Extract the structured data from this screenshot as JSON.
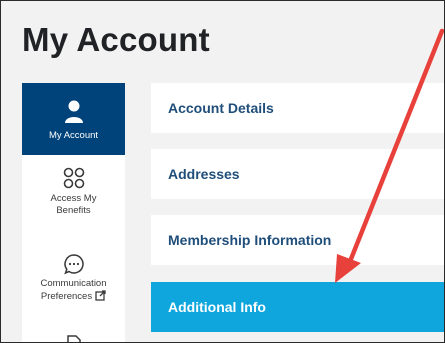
{
  "page": {
    "title": "My Account"
  },
  "sidebar": {
    "items": [
      {
        "label": "My Account",
        "icon": "user-icon"
      },
      {
        "label": "Access My Benefits",
        "icon": "grid-icon"
      },
      {
        "label": "Communication Preferences",
        "icon": "chat-bubble-icon",
        "external_icon": "external-link-icon"
      },
      {
        "label": "",
        "icon": "document-icon"
      }
    ]
  },
  "menu": {
    "items": [
      {
        "label": "Account Details"
      },
      {
        "label": "Addresses"
      },
      {
        "label": "Membership Information"
      },
      {
        "label": "Additional Info",
        "active": true
      }
    ]
  },
  "colors": {
    "sidebar_active": "#00427a",
    "menu_active": "#0ea6dc",
    "menu_text": "#1f4e7a",
    "annotation_arrow": "#e8403b"
  }
}
